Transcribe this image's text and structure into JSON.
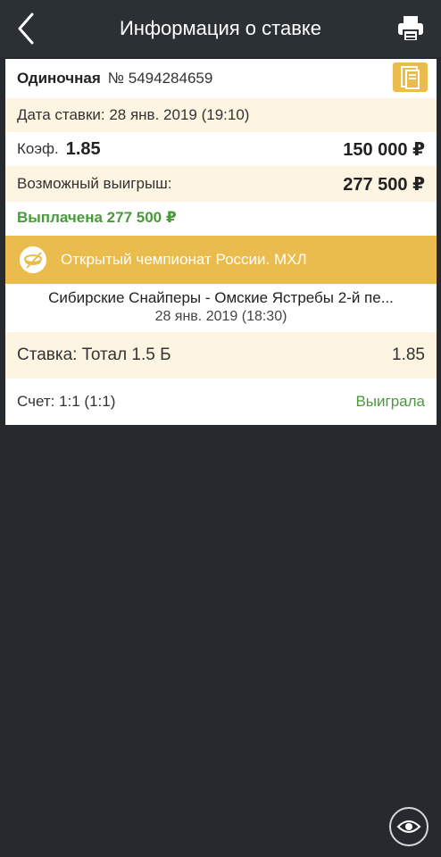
{
  "header": {
    "title": "Информация о ставке",
    "back_icon": "chevron-left-icon",
    "print_icon": "printer-icon"
  },
  "bet": {
    "type": "Одиночная",
    "number": "№ 5494284659",
    "date_label": "Дата ставки: 28 янв. 2019 (19:10)",
    "coef_label": "Коэф.",
    "coef_value": "1.85",
    "stake_amount": "150 000 ₽",
    "possible_win_label": "Возможный выигрыш:",
    "possible_win_value": "277 500 ₽",
    "paid_label": "Выплачена 277 500 ₽"
  },
  "event": {
    "league": "Открытый чемпионат России. МХЛ",
    "teams": "Сибирские Снайперы - Омские Ястребы 2-й пе...",
    "date": "28 янв. 2019 (18:30)",
    "selection_label": "Ставка: Тотал 1.5 Б",
    "selection_coef": "1.85",
    "score": "Счет: 1:1 (1:1)",
    "result": "Выиграла"
  },
  "colors": {
    "accent": "#e9bc4d",
    "background": "#262a2f",
    "topbar": "#2b3035",
    "cream_row": "#fdf4e2",
    "won_green": "#4a9a3c"
  }
}
